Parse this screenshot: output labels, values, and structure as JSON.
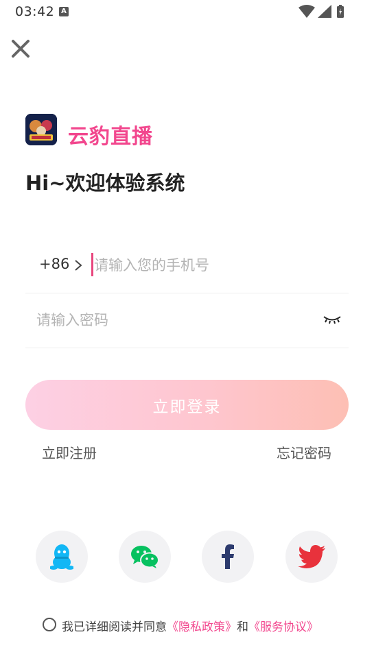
{
  "status_bar": {
    "time": "03:42",
    "notification_icon": "A"
  },
  "brand": {
    "app_name": "云豹直播"
  },
  "greeting": "Hi~欢迎体验系统",
  "form": {
    "country_code": "+86",
    "phone_placeholder": "请输入您的手机号",
    "password_placeholder": "请输入密码",
    "login_label": "立即登录",
    "register_label": "立即注册",
    "forgot_label": "忘记密码"
  },
  "social": [
    {
      "name": "qq",
      "icon": "qq-penguin-icon",
      "color": "#12b7f5"
    },
    {
      "name": "wechat",
      "icon": "wechat-icon",
      "color": "#07c160"
    },
    {
      "name": "facebook",
      "icon": "facebook-icon",
      "color": "#2d3b6e"
    },
    {
      "name": "twitter",
      "icon": "twitter-bird-icon",
      "color": "#e8323c"
    }
  ],
  "agreement": {
    "prefix": "我已详细阅读并同意",
    "privacy": "《隐私政策》",
    "and": "和",
    "service": "《服务协议》"
  },
  "colors": {
    "accent": "#f2478e",
    "button_gradient_start": "#fdd0e4",
    "button_gradient_end": "#fdbfb4"
  }
}
